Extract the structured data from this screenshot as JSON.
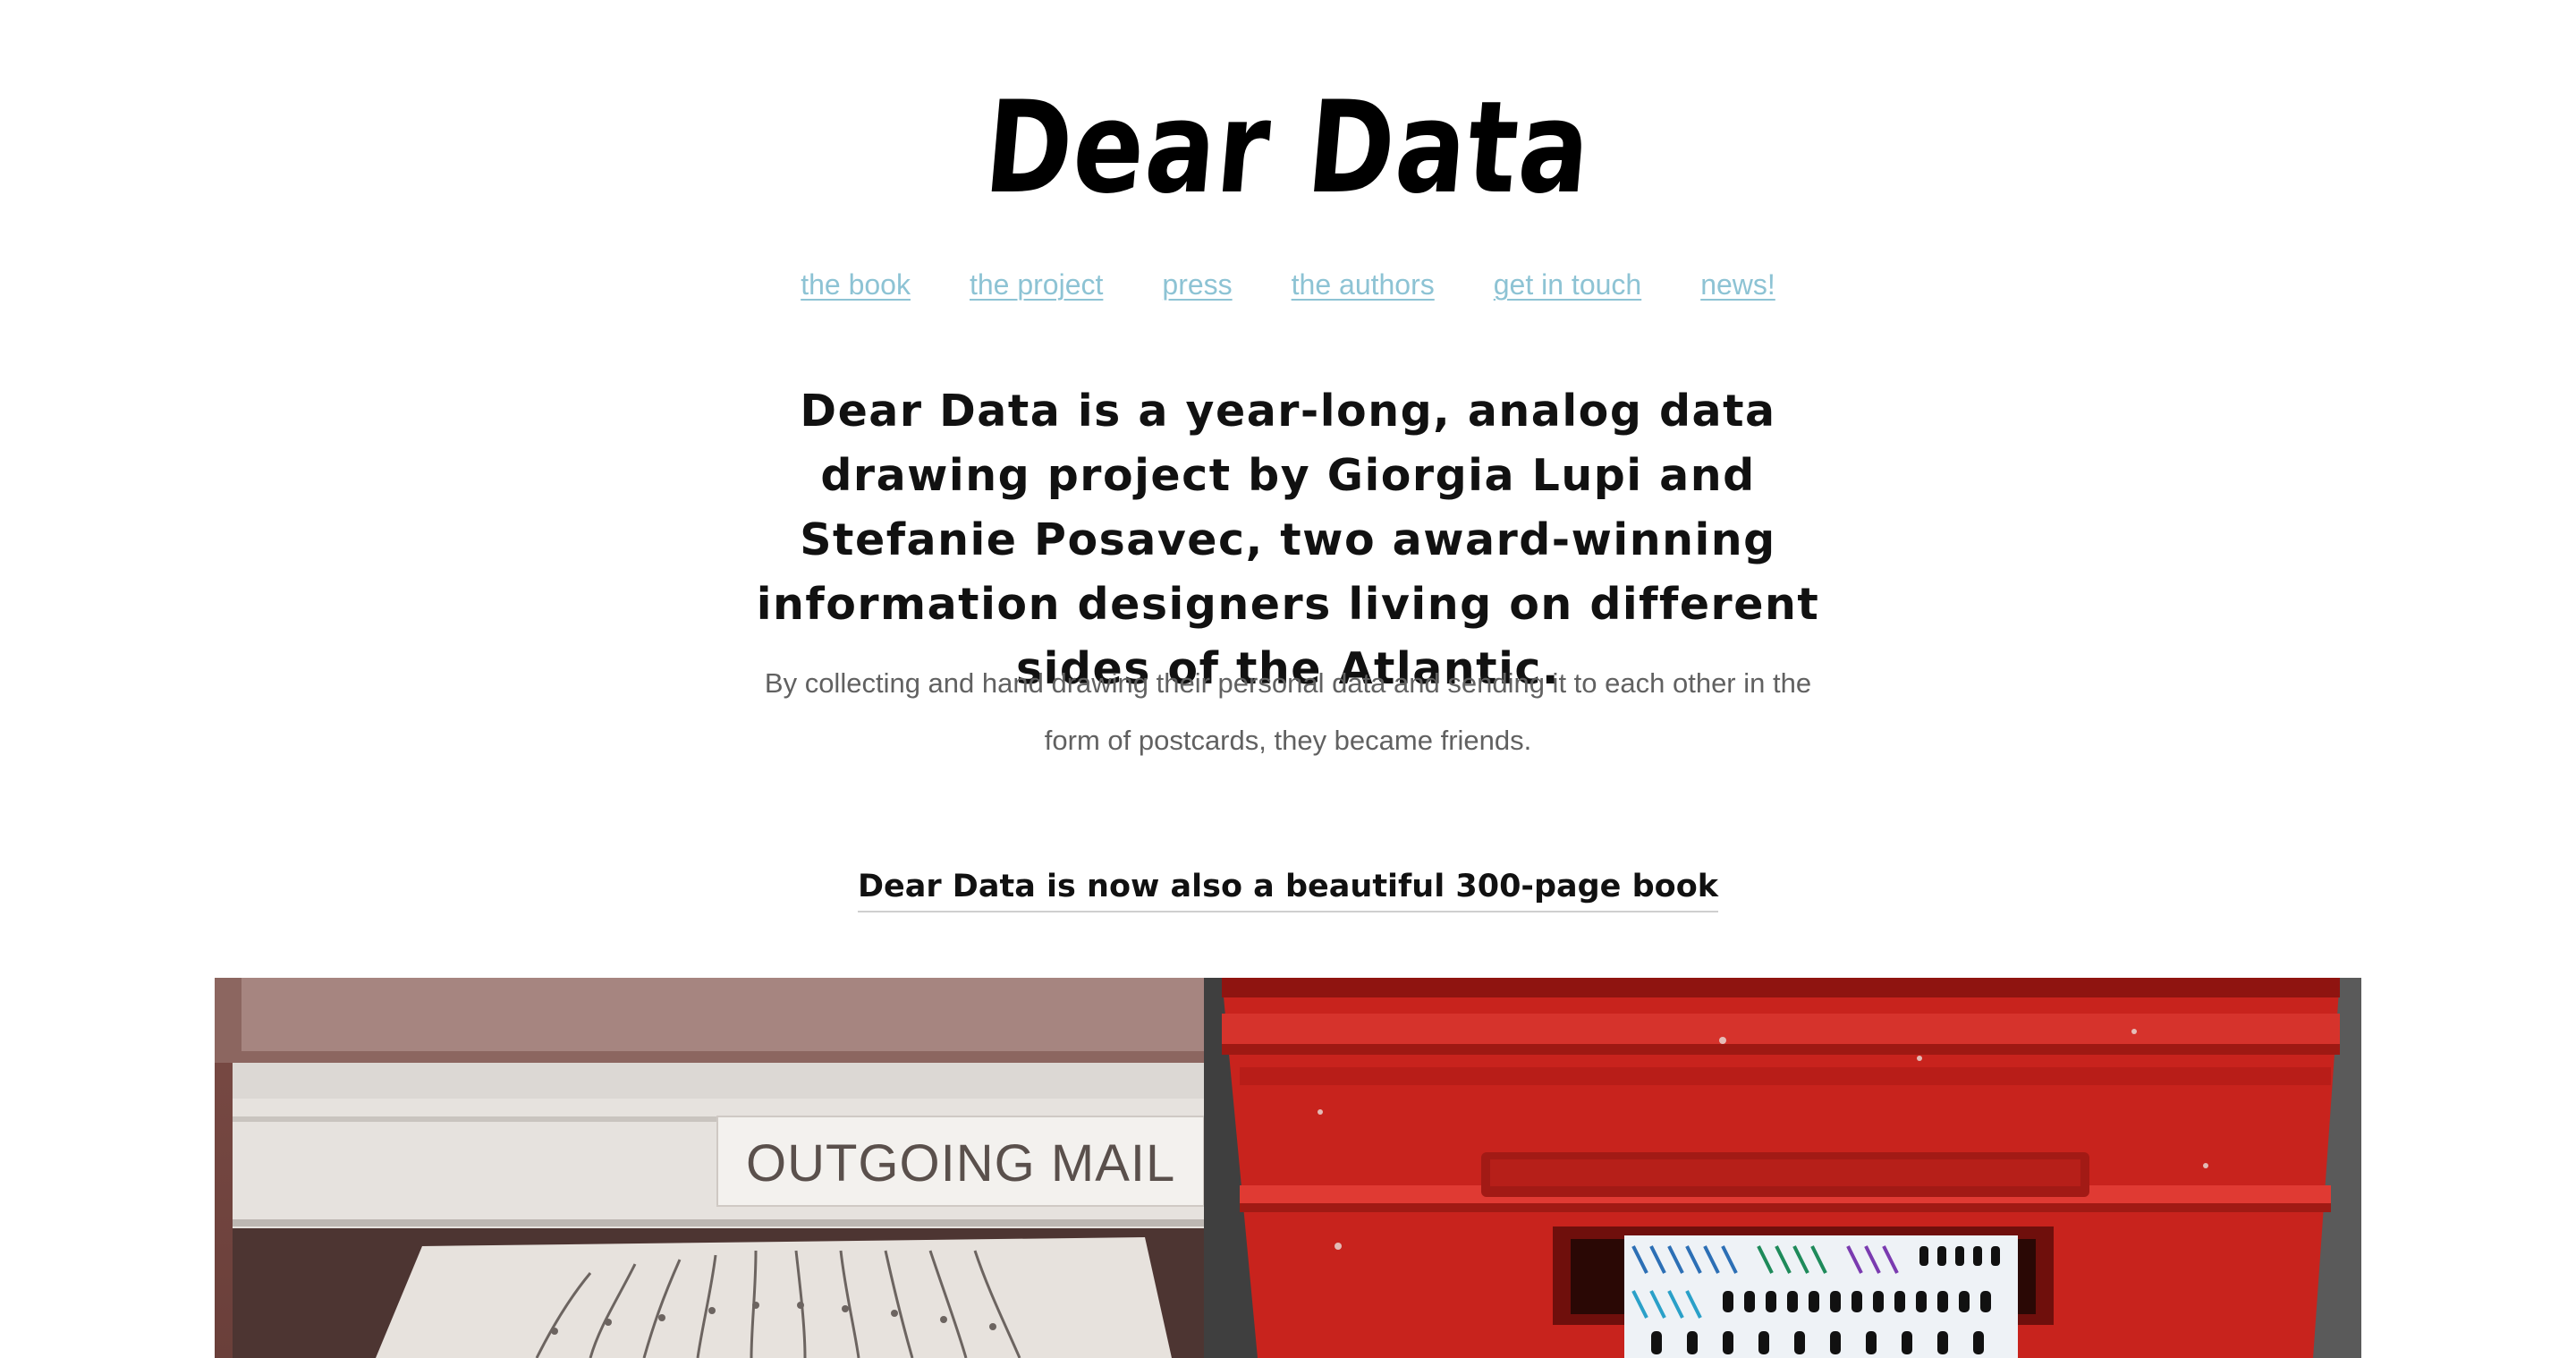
{
  "site": {
    "logo_text": "Dear Data"
  },
  "nav": {
    "items": [
      {
        "label": "the book"
      },
      {
        "label": "the project"
      },
      {
        "label": "press"
      },
      {
        "label": "the authors"
      },
      {
        "label": "get in touch"
      },
      {
        "label": "news!"
      }
    ],
    "link_color": "#8dc3d4"
  },
  "intro": {
    "headline": "Dear Data is a year-long, analog data drawing project by Giorgia Lupi and Stefanie Posavec, two award-winning information designers living on different sides of the Atlantic.",
    "subtext": "By collecting and hand drawing their personal data and sending it to each other in the form of postcards, they became friends."
  },
  "book": {
    "link_text": "Dear Data is now also a beautiful 300-page book"
  },
  "hero": {
    "left_photo_label": "OUTGOING MAIL",
    "left_photo_icon": "outgoing-mail-photo",
    "right_photo_icon": "red-postbox-photo",
    "postbox_color": "#c8231d"
  }
}
